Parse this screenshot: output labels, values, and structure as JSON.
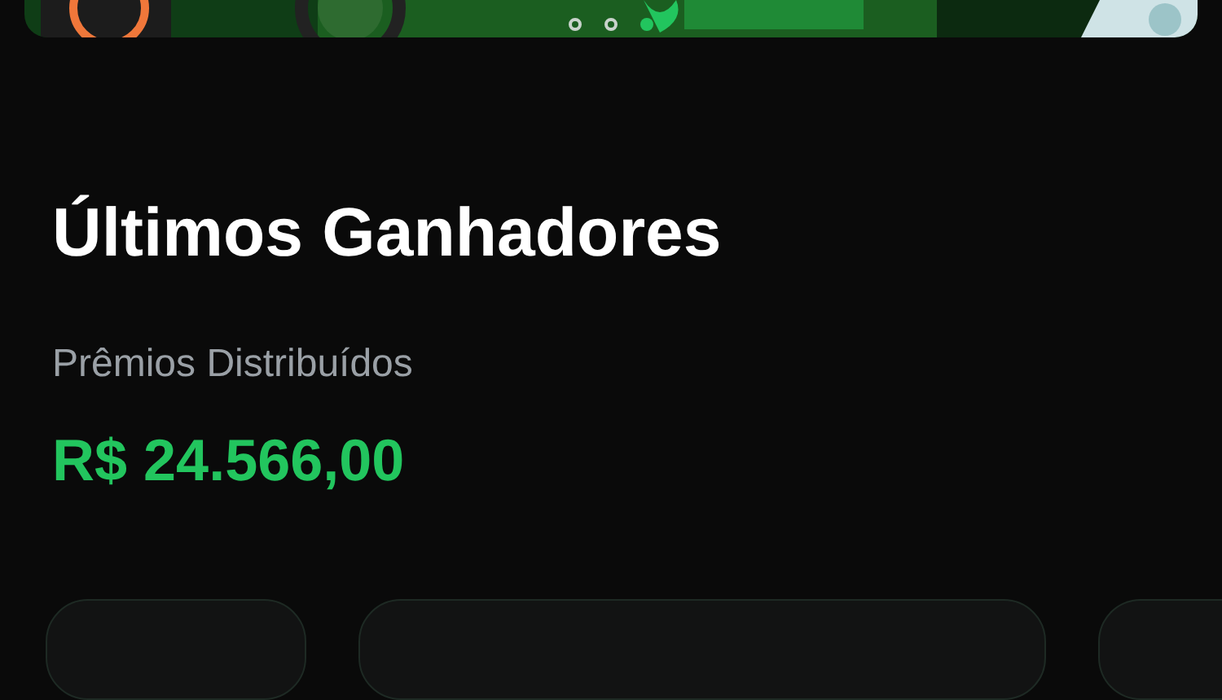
{
  "banner": {
    "kind": "picture",
    "dots": [
      {
        "selected": false
      },
      {
        "selected": false
      },
      {
        "selected": true
      }
    ]
  },
  "section": {
    "title": "Últimos Ganhadores",
    "prize_label": "Prêmios Distribuídos",
    "prize_total": "R$ 24.566,00"
  },
  "cards": [
    {
      "kind": "card"
    },
    {
      "kind": "card"
    },
    {
      "kind": "card"
    }
  ]
}
